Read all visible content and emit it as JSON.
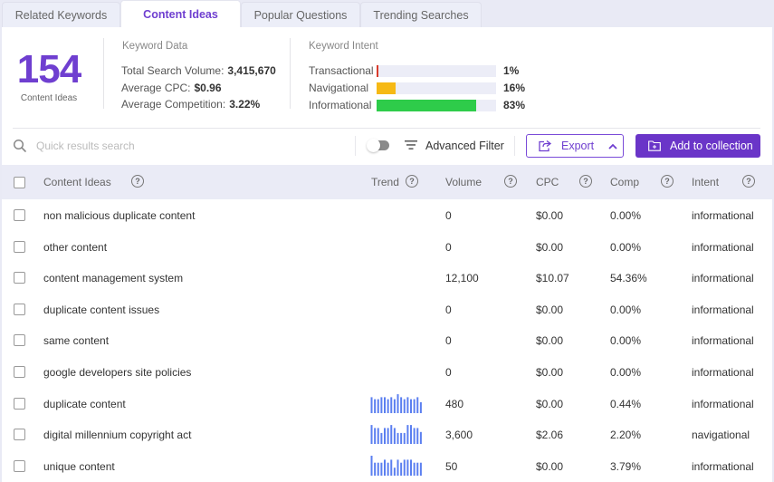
{
  "tabs": [
    {
      "label": "Related Keywords",
      "active": false
    },
    {
      "label": "Content Ideas",
      "active": true
    },
    {
      "label": "Popular Questions",
      "active": false
    },
    {
      "label": "Trending Searches",
      "active": false
    }
  ],
  "summary": {
    "count": "154",
    "count_label": "Content Ideas",
    "keyword_data": {
      "title": "Keyword Data",
      "rows": [
        {
          "label": "Total Search Volume:",
          "value": "3,415,670"
        },
        {
          "label": "Average CPC:",
          "value": "$0.96"
        },
        {
          "label": "Average Competition:",
          "value": "3.22%"
        }
      ]
    },
    "keyword_intent": {
      "title": "Keyword Intent",
      "rows": [
        {
          "label": "Transactional",
          "percent": 1,
          "display": "1%",
          "color": "#d93b2b"
        },
        {
          "label": "Navigational",
          "percent": 16,
          "display": "16%",
          "color": "#f6b915"
        },
        {
          "label": "Informational",
          "percent": 83,
          "display": "83%",
          "color": "#2ecc4a"
        }
      ]
    }
  },
  "toolbar": {
    "search_placeholder": "Quick results search",
    "search_value": "",
    "toggle_on": false,
    "advanced_filter_label": "Advanced Filter",
    "export_label": "Export",
    "add_collection_label": "Add to collection"
  },
  "colors": {
    "accent": "#6f3fd0",
    "button_primary": "#6a35c8",
    "sparkline": "#5b7ff0",
    "header_bg": "#eaebf6"
  },
  "table": {
    "headers": {
      "keyword": "Content Ideas",
      "trend": "Trend",
      "volume": "Volume",
      "cpc": "CPC",
      "comp": "Comp",
      "intent": "Intent"
    },
    "rows": [
      {
        "keyword": "non malicious duplicate content",
        "trend": null,
        "volume": "0",
        "cpc": "$0.00",
        "comp": "0.00%",
        "intent": "informational"
      },
      {
        "keyword": "other content",
        "trend": null,
        "volume": "0",
        "cpc": "$0.00",
        "comp": "0.00%",
        "intent": "informational"
      },
      {
        "keyword": "content management system",
        "trend": null,
        "volume": "12,100",
        "cpc": "$10.07",
        "comp": "54.36%",
        "intent": "informational"
      },
      {
        "keyword": "duplicate content issues",
        "trend": null,
        "volume": "0",
        "cpc": "$0.00",
        "comp": "0.00%",
        "intent": "informational"
      },
      {
        "keyword": "same content",
        "trend": null,
        "volume": "0",
        "cpc": "$0.00",
        "comp": "0.00%",
        "intent": "informational"
      },
      {
        "keyword": "google developers site policies",
        "trend": null,
        "volume": "0",
        "cpc": "$0.00",
        "comp": "0.00%",
        "intent": "informational"
      },
      {
        "keyword": "duplicate content",
        "trend": [
          0.8,
          0.7,
          0.7,
          0.8,
          0.8,
          0.7,
          0.8,
          0.7,
          0.95,
          0.8,
          0.7,
          0.8,
          0.7,
          0.7,
          0.8,
          0.55
        ],
        "volume": "480",
        "cpc": "$0.00",
        "comp": "0.44%",
        "intent": "informational"
      },
      {
        "keyword": "digital millennium copyright act",
        "trend": [
          0.95,
          0.8,
          0.8,
          0.55,
          0.8,
          0.8,
          0.95,
          0.8,
          0.55,
          0.55,
          0.55,
          0.95,
          0.95,
          0.8,
          0.8,
          0.6
        ],
        "volume": "3,600",
        "cpc": "$2.06",
        "comp": "2.20%",
        "intent": "navigational"
      },
      {
        "keyword": "unique content",
        "trend": [
          1.0,
          0.65,
          0.65,
          0.65,
          0.8,
          0.65,
          0.8,
          0.4,
          0.8,
          0.65,
          0.8,
          0.8,
          0.8,
          0.65,
          0.65,
          0.65
        ],
        "volume": "50",
        "cpc": "$0.00",
        "comp": "3.79%",
        "intent": "informational"
      }
    ]
  }
}
